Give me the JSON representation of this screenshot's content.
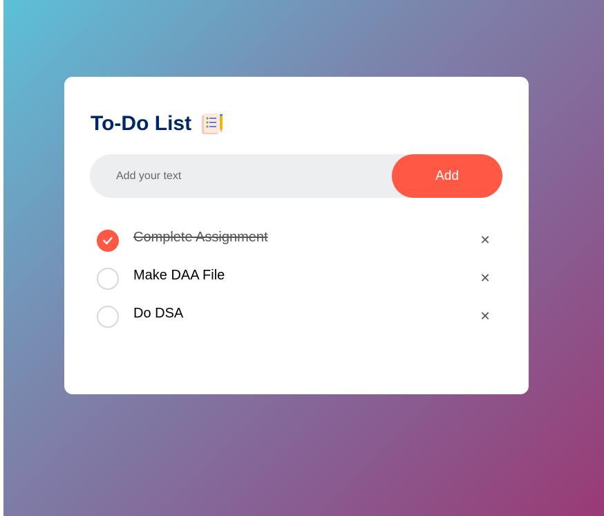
{
  "app": {
    "title": "To-Do List"
  },
  "input": {
    "placeholder": "Add your text",
    "value": "",
    "add_label": "Add"
  },
  "tasks": [
    {
      "text": "Complete Assignment",
      "done": true,
      "remove_icon": "close-icon"
    },
    {
      "text": "Make DAA File",
      "done": false,
      "remove_icon": "close-icon"
    },
    {
      "text": "Do DSA",
      "done": false,
      "remove_icon": "close-icon"
    }
  ],
  "icons": {
    "title": "checklist-notepad-icon",
    "checked": "checkmark-icon",
    "remove": "close-icon"
  },
  "colors": {
    "accent": "#ff5945",
    "title": "#002765",
    "input_bg": "#edeef0",
    "gradient_start": "#5cc0d8",
    "gradient_end": "#9a3a74"
  }
}
